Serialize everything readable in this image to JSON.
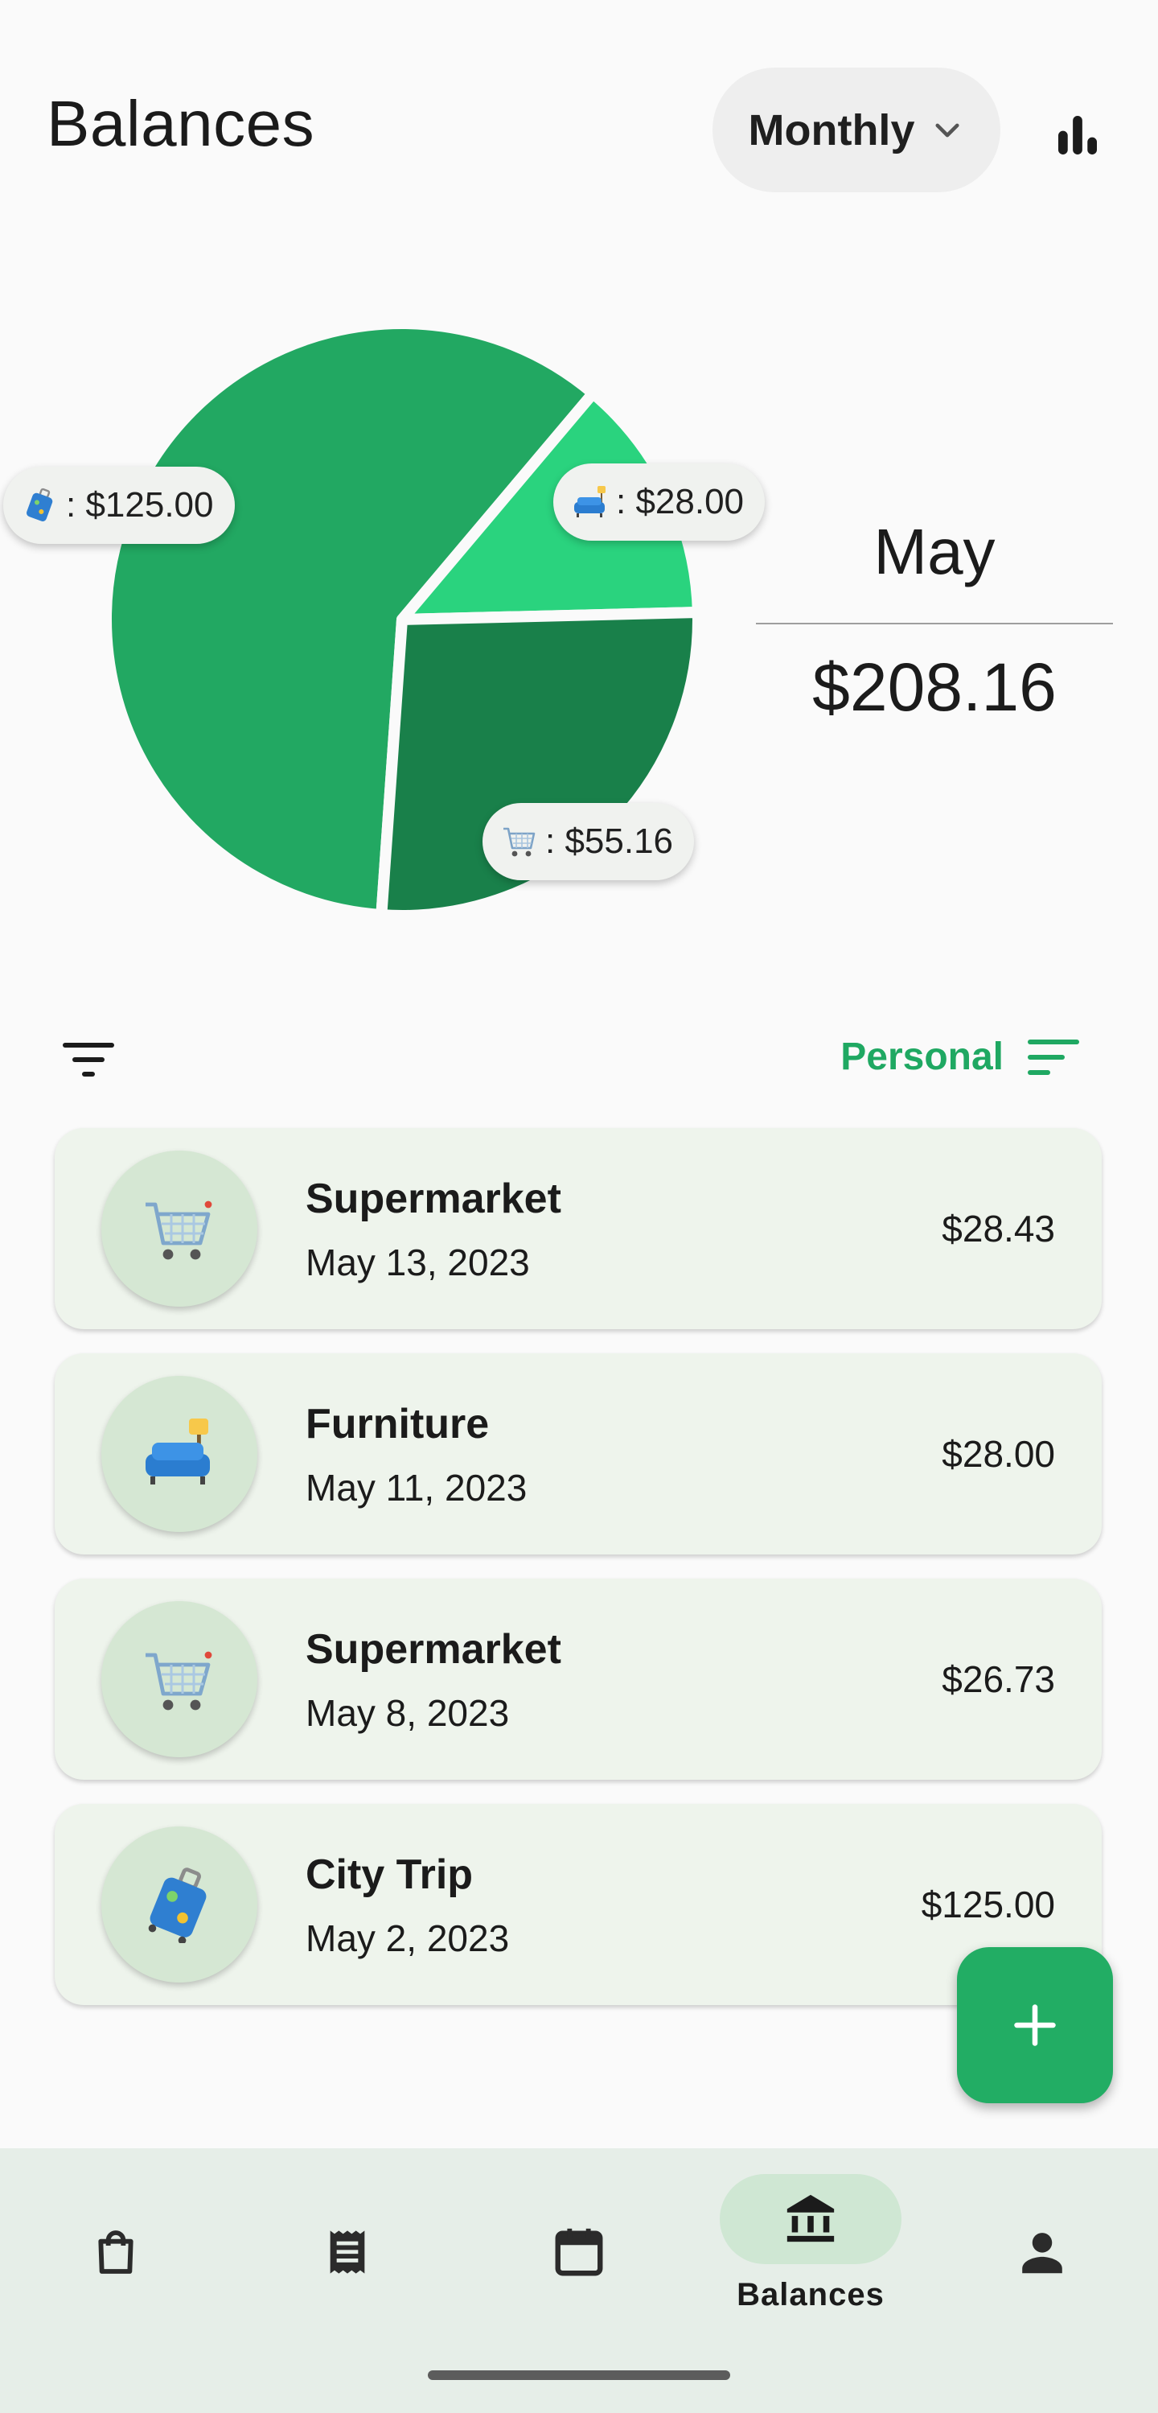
{
  "header": {
    "title": "Balances",
    "period_select": {
      "value": "Monthly"
    }
  },
  "summary": {
    "month": "May",
    "total": "$208.16"
  },
  "chart_data": {
    "type": "pie",
    "title": "",
    "slices": [
      {
        "category": "Travel",
        "icon": "suitcase-icon",
        "label": ": $125.00",
        "value": 125.0,
        "color": "#22a862"
      },
      {
        "category": "Furniture",
        "icon": "couch-lamp-icon",
        "label": ": $28.00",
        "value": 28.0,
        "color": "#2ad37e"
      },
      {
        "category": "Groceries",
        "icon": "shopping-cart-icon",
        "label": ": $55.16",
        "value": 55.16,
        "color": "#19804a"
      }
    ]
  },
  "filters": {
    "group_label": "Personal"
  },
  "transactions": [
    {
      "name": "Supermarket",
      "date": "May 13, 2023",
      "amount": "$28.43",
      "icon": "shopping-cart-icon"
    },
    {
      "name": "Furniture",
      "date": "May 11, 2023",
      "amount": "$28.00",
      "icon": "couch-lamp-icon"
    },
    {
      "name": "Supermarket",
      "date": "May 8, 2023",
      "amount": "$26.73",
      "icon": "shopping-cart-icon"
    },
    {
      "name": "City Trip",
      "date": "May 2, 2023",
      "amount": "$125.00",
      "icon": "suitcase-icon"
    }
  ],
  "bottom_nav": {
    "items": [
      {
        "icon": "shopping-bag-icon",
        "label": ""
      },
      {
        "icon": "receipt-icon",
        "label": ""
      },
      {
        "icon": "calendar-icon",
        "label": ""
      },
      {
        "icon": "bank-icon",
        "label": "Balances",
        "active": true
      },
      {
        "icon": "person-icon",
        "label": ""
      }
    ]
  },
  "colors": {
    "accent": "#22ad64",
    "card_bg": "#eef4ec",
    "avatar_bg": "#d5e7d3",
    "nav_bg": "#e6eee8"
  }
}
